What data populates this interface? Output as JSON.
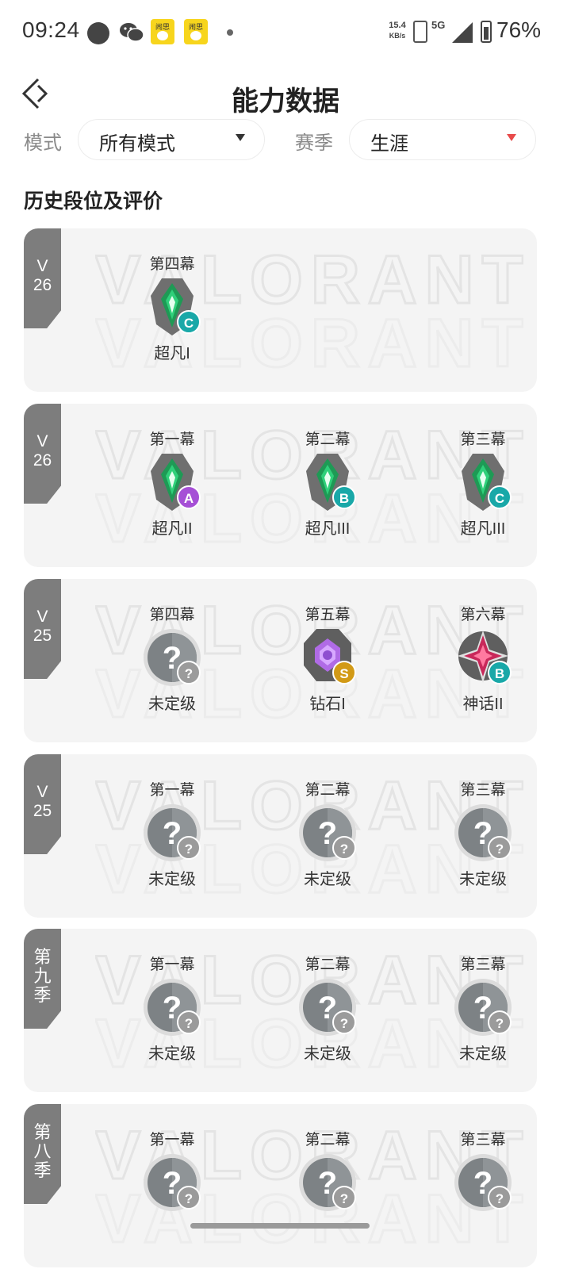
{
  "status_bar": {
    "time": "09:24",
    "speed_top": "15.4",
    "speed_unit": "KB/s",
    "network": "5G",
    "battery": "76%",
    "notification_app_label": "闹思"
  },
  "header": {
    "title": "能力数据"
  },
  "filters": {
    "mode_label": "模式",
    "mode_value": "所有模式",
    "season_label": "赛季",
    "season_value": "生涯"
  },
  "section_title": "历史段位及评价",
  "seasons": [
    {
      "tag": "V\n26",
      "acts": [
        {
          "act": "第四幕",
          "rank": "超凡I",
          "grade": "C",
          "tier": "ascendant"
        }
      ]
    },
    {
      "tag": "V\n26",
      "acts": [
        {
          "act": "第一幕",
          "rank": "超凡II",
          "grade": "A",
          "tier": "ascendant"
        },
        {
          "act": "第二幕",
          "rank": "超凡III",
          "grade": "B",
          "tier": "ascendant"
        },
        {
          "act": "第三幕",
          "rank": "超凡III",
          "grade": "C",
          "tier": "ascendant"
        }
      ]
    },
    {
      "tag": "V\n25",
      "acts": [
        {
          "act": "第四幕",
          "rank": "未定级",
          "grade": "?",
          "tier": "unranked"
        },
        {
          "act": "第五幕",
          "rank": "钻石I",
          "grade": "S",
          "tier": "diamond"
        },
        {
          "act": "第六幕",
          "rank": "神话II",
          "grade": "B",
          "tier": "immortal"
        }
      ]
    },
    {
      "tag": "V\n25",
      "acts": [
        {
          "act": "第一幕",
          "rank": "未定级",
          "grade": "?",
          "tier": "unranked"
        },
        {
          "act": "第二幕",
          "rank": "未定级",
          "grade": "?",
          "tier": "unranked"
        },
        {
          "act": "第三幕",
          "rank": "未定级",
          "grade": "?",
          "tier": "unranked"
        }
      ]
    },
    {
      "tag": "第\n九\n季",
      "acts": [
        {
          "act": "第一幕",
          "rank": "未定级",
          "grade": "?",
          "tier": "unranked"
        },
        {
          "act": "第二幕",
          "rank": "未定级",
          "grade": "?",
          "tier": "unranked"
        },
        {
          "act": "第三幕",
          "rank": "未定级",
          "grade": "?",
          "tier": "unranked"
        }
      ]
    },
    {
      "tag": "第\n八\n季",
      "acts": [
        {
          "act": "第一幕",
          "rank": "",
          "grade": "?",
          "tier": "unranked"
        },
        {
          "act": "第二幕",
          "rank": "",
          "grade": "?",
          "tier": "unranked"
        },
        {
          "act": "第三幕",
          "rank": "",
          "grade": "?",
          "tier": "unranked"
        }
      ]
    }
  ],
  "colors": {
    "card_bg": "#f4f4f4",
    "tag_bg": "#7d7d7d",
    "grade_teal": "#19a8a8",
    "grade_purple": "#a64fd6",
    "grade_gold": "#d29a16",
    "grade_unknown": "#9b9b9b",
    "ascendant_green": "#1e9a55",
    "diamond_purple": "#b06be6",
    "immortal_red": "#c8285a"
  }
}
